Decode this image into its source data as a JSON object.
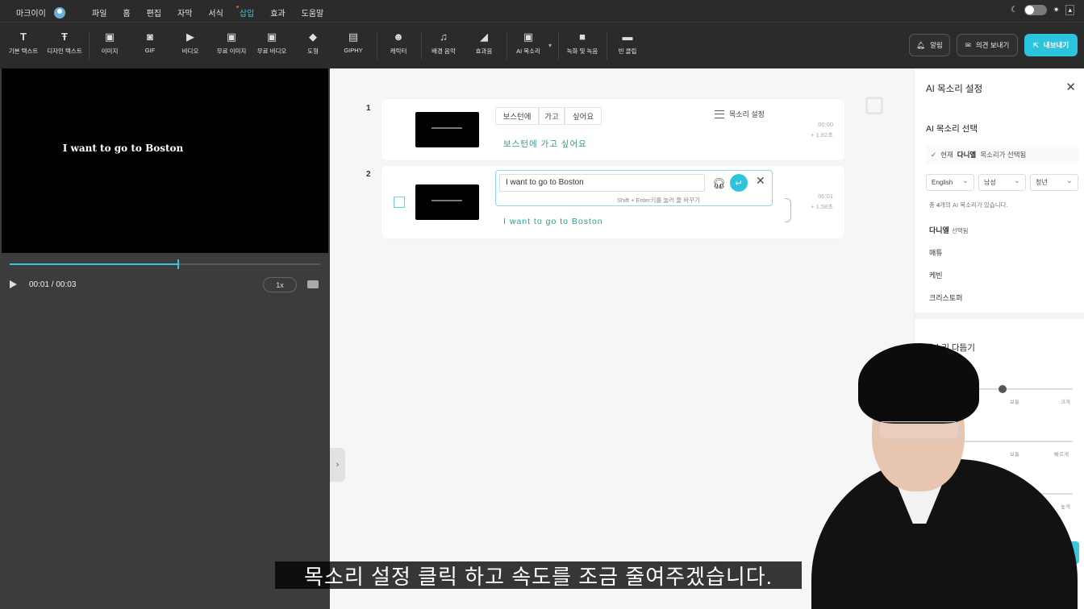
{
  "menubar": {
    "brand": "마크이이",
    "items": [
      "파일",
      "홈",
      "편집",
      "자막",
      "서식",
      "삽입",
      "효과",
      "도움말"
    ],
    "active": "삽입"
  },
  "toolbar": {
    "tools": [
      {
        "label": "기본 텍스트",
        "icon": "T"
      },
      {
        "label": "디자인 텍스트",
        "icon": "Ŧ"
      },
      {
        "label": "이미지",
        "icon": "▣"
      },
      {
        "label": "GIF",
        "icon": "◙"
      },
      {
        "label": "비디오",
        "icon": "▶"
      },
      {
        "label": "무료 이미지",
        "icon": "▣"
      },
      {
        "label": "무료 비디오",
        "icon": "▣"
      },
      {
        "label": "도형",
        "icon": "◆"
      },
      {
        "label": "GIPHY",
        "icon": "▤"
      },
      {
        "label": "캐릭터",
        "icon": "☻"
      },
      {
        "label": "배경 음악",
        "icon": "♫"
      },
      {
        "label": "효과음",
        "icon": "◢"
      },
      {
        "label": "AI 목소리",
        "icon": "▣"
      },
      {
        "label": "녹화 및 녹음",
        "icon": "■"
      },
      {
        "label": "빈 클립",
        "icon": "▬"
      }
    ],
    "alert_label": "알림",
    "feedback_label": "의견 보내기",
    "export_label": "내보내기"
  },
  "preview": {
    "video_text": "I want to go to Boston",
    "timecode": "00:01 / 00:03",
    "speed": "1x",
    "progress": 0.54
  },
  "scenes": [
    {
      "number": "1",
      "chips": [
        "보스턴에",
        "가고",
        "싶어요"
      ],
      "voice_settings_label": "목소리 설정",
      "text": "보스턴에 가고 싶어요",
      "time": "00:00",
      "duration": "+ 1.82초"
    },
    {
      "number": "2",
      "input_value": "I want to go to Boston",
      "hint": "Shift + Enter키를 눌러 줄 바꾸기",
      "text": "I want to go to Boston",
      "time": "00:01",
      "duration": "+ 1.58초"
    }
  ],
  "panel": {
    "title": "AI 목소리 설정",
    "select_title": "AI 목소리 선택",
    "current_prefix": "현재",
    "current_voice": "다니엘",
    "current_suffix": "목소리가 선택됨",
    "dropdowns": [
      "English",
      "남성",
      "청년"
    ],
    "count_prefix": "총",
    "count_number": "4",
    "count_suffix": "개의 AI 목소리가 있습니다.",
    "voices": [
      {
        "name": "다니엘",
        "tag": "선택됨"
      },
      {
        "name": "매튜",
        "tag": ""
      },
      {
        "name": "케빈",
        "tag": ""
      },
      {
        "name": "크리스토퍼",
        "tag": ""
      }
    ],
    "tune_title": "목소리 다듬기",
    "slider1_labels": [
      "보통",
      "크게"
    ],
    "slider2_labels": [
      "보통",
      "빠르게"
    ],
    "slider3_labels": [
      "높게"
    ]
  },
  "caption": "목소리 설정 클릭 하고 속도를 조금 줄여주겠습니다."
}
